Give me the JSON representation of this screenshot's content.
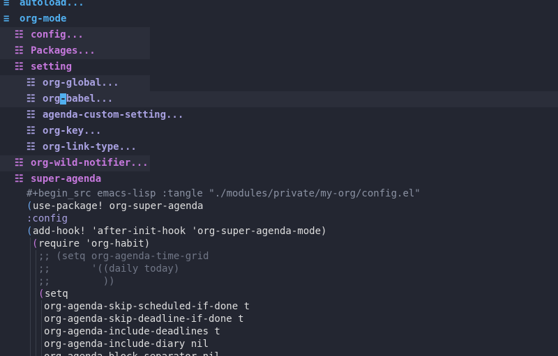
{
  "colors": {
    "background": "#232631",
    "level1": "#51afef",
    "level2": "#c678dd",
    "level3": "#a9a1e1",
    "meta": "#8b92a3",
    "paren": "#6ca8ef",
    "text": "#dfdfdf",
    "comment": "#717787",
    "current_line": "#2b2e3a",
    "cursor": "#51afef"
  },
  "headings": [
    {
      "level": 1,
      "bullet_icon": "bullet-level1-icon",
      "bullet": "≡",
      "text": "autoload..."
    },
    {
      "level": 1,
      "bullet_icon": "bullet-level1-icon",
      "bullet": "≡",
      "text": "org-mode"
    },
    {
      "level": 2,
      "bullet_icon": "bullet-level2-icon",
      "bullet": "☷",
      "text": "config..."
    },
    {
      "level": 2,
      "bullet_icon": "bullet-level2-icon",
      "bullet": "☷",
      "text": "Packages..."
    },
    {
      "level": 2,
      "bullet_icon": "bullet-level2-icon",
      "bullet": "☷",
      "text": "setting"
    },
    {
      "level": 3,
      "bullet_icon": "bullet-level3-icon",
      "bullet": "☷",
      "text": "org-global..."
    },
    {
      "level": 3,
      "bullet_icon": "bullet-level3-icon",
      "bullet": "☷",
      "text_before_cursor": "org",
      "cursor_char": "-",
      "text_after_cursor": "babel..."
    },
    {
      "level": 3,
      "bullet_icon": "bullet-level3-icon",
      "bullet": "☷",
      "text": "agenda-custom-setting..."
    },
    {
      "level": 3,
      "bullet_icon": "bullet-level3-icon",
      "bullet": "☷",
      "text": "org-key..."
    },
    {
      "level": 3,
      "bullet_icon": "bullet-level3-icon",
      "bullet": "☷",
      "text": "org-link-type..."
    },
    {
      "level": 2,
      "bullet_icon": "bullet-level2-icon",
      "bullet": "☷",
      "text": "org-wild-notifier..."
    },
    {
      "level": 2,
      "bullet_icon": "bullet-level2-icon",
      "bullet": "☷",
      "text": "super-agenda"
    }
  ],
  "code": [
    {
      "kind": "meta",
      "text": "#+begin_src emacs-lisp :tangle \"./modules/private/my-org/config.el\""
    },
    {
      "kind": "form",
      "open": "(",
      "text": "use-package! org-super-agenda"
    },
    {
      "kind": "keyword",
      "text": ":config"
    },
    {
      "kind": "form",
      "open": "(",
      "text": "add-hook! 'after-init-hook 'org-super-agenda-mode)"
    },
    {
      "kind": "form",
      "open": "(",
      "text": "require 'org-habit)"
    },
    {
      "kind": "comment",
      "text": ";; (setq org-agenda-time-grid"
    },
    {
      "kind": "comment",
      "text": ";;       '((daily today)"
    },
    {
      "kind": "comment",
      "text": ";;         ))"
    },
    {
      "kind": "form",
      "open": "(",
      "text": "setq"
    },
    {
      "kind": "plain",
      "text": "org-agenda-skip-scheduled-if-done t"
    },
    {
      "kind": "plain",
      "text": "org-agenda-skip-deadline-if-done t"
    },
    {
      "kind": "plain",
      "text": "org-agenda-include-deadlines t"
    },
    {
      "kind": "plain",
      "text": "org-agenda-include-diary nil"
    },
    {
      "kind": "plain",
      "text": "org-agenda-block-separator nil"
    }
  ]
}
